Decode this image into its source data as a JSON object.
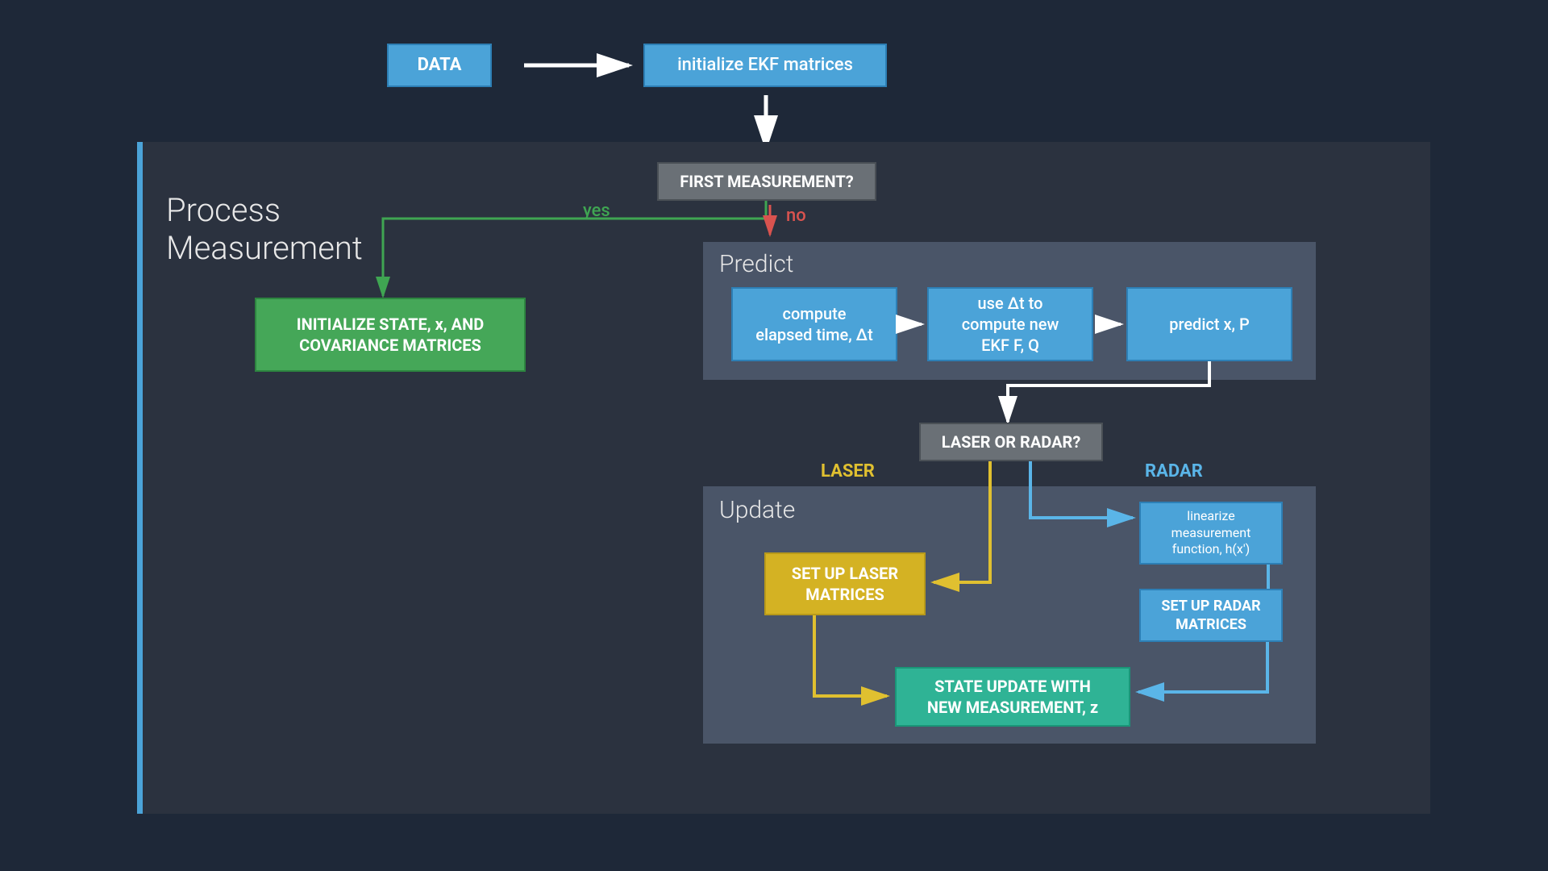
{
  "top": {
    "data": "DATA",
    "init": "initialize EKF matrices"
  },
  "process": {
    "title": "Process\nMeasurement",
    "first_q": "FIRST MEASUREMENT?",
    "yes": "yes",
    "no": "no",
    "init_state": "INITIALIZE STATE, x, AND\nCOVARIANCE MATRICES"
  },
  "predict": {
    "title": "Predict",
    "elapsed": "compute\nelapsed time, Δt",
    "compute_fq": "use Δt to\ncompute new\nEKF F, Q",
    "predict_xp": "predict x, P"
  },
  "decision": {
    "laser_or_radar": "LASER OR RADAR?",
    "laser": "LASER",
    "radar": "RADAR"
  },
  "update": {
    "title": "Update",
    "set_laser": "SET UP LASER\nMATRICES",
    "linearize": "linearize\nmeasurement\nfunction, h(x')",
    "set_radar": "SET UP RADAR\nMATRICES",
    "state_update": "STATE UPDATE WITH\nNEW MEASUREMENT, z"
  },
  "colors": {
    "blue": "#4ba3d8",
    "blue_light": "#5ab5e8",
    "green": "#45a758",
    "green_line": "#3fa552",
    "yellow": "#d4b223",
    "yellow_line": "#e0c030",
    "red": "#d9534f",
    "teal": "#2fb395",
    "grey": "#6a7076",
    "white": "#ffffff"
  }
}
